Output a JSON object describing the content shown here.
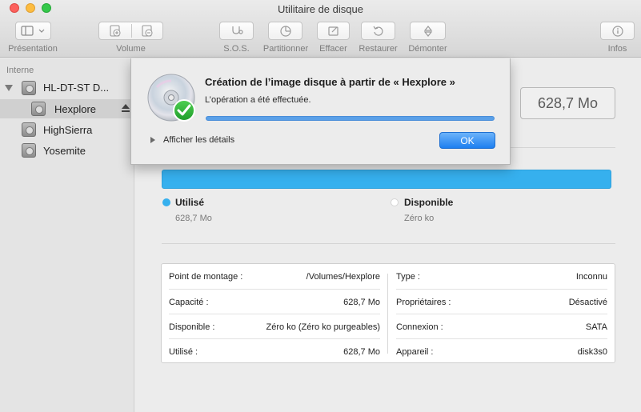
{
  "window": {
    "title": "Utilitaire de disque"
  },
  "toolbar": {
    "presentation_label": "Présentation",
    "volume_label": "Volume",
    "sos_label": "S.O.S.",
    "partition_label": "Partitionner",
    "erase_label": "Effacer",
    "restore_label": "Restaurer",
    "unmount_label": "Démonter",
    "info_label": "Infos"
  },
  "sidebar": {
    "section": "Interne",
    "items": [
      {
        "label": "HL-DT-ST D..."
      },
      {
        "label": "Hexplore"
      },
      {
        "label": "HighSierra"
      },
      {
        "label": "Yosemite"
      }
    ]
  },
  "main": {
    "size": "628,7 Mo",
    "used_label": "Utilisé",
    "used_value": "628,7 Mo",
    "free_label": "Disponible",
    "free_value": "Zéro ko",
    "used_color": "#36b0ee",
    "info_left": [
      {
        "key": "Point de montage :",
        "value": "/Volumes/Hexplore"
      },
      {
        "key": "Capacité :",
        "value": "628,7 Mo"
      },
      {
        "key": "Disponible :",
        "value": "Zéro ko (Zéro ko purgeables)"
      },
      {
        "key": "Utilisé :",
        "value": "628,7 Mo"
      }
    ],
    "info_right": [
      {
        "key": "Type :",
        "value": "Inconnu"
      },
      {
        "key": "Propriétaires :",
        "value": "Désactivé"
      },
      {
        "key": "Connexion :",
        "value": "SATA"
      },
      {
        "key": "Appareil :",
        "value": "disk3s0"
      }
    ]
  },
  "sheet": {
    "title": "Création de l’image disque à partir de « Hexplore »",
    "message": "L’opération a été effectuée.",
    "progress": 1.0,
    "details_label": "Afficher les détails",
    "ok_label": "OK"
  }
}
